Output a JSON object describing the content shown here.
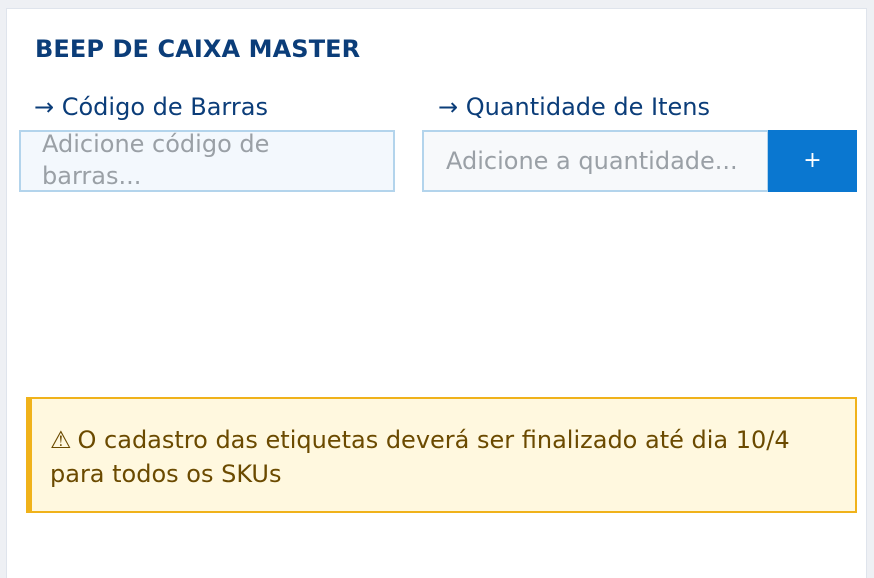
{
  "header": {
    "title": "BEEP DE CAIXA MASTER"
  },
  "barcode": {
    "label": "→ Código de Barras",
    "placeholder": "Adicione código de barras..."
  },
  "quantity": {
    "label": "→ Quantidade de Itens",
    "placeholder": "Adicione a quantidade..."
  },
  "add_button": {
    "label": "+"
  },
  "alert": {
    "icon": "⚠",
    "icon_name": "warning-icon",
    "message": "O cadastro das etiquetas deverá ser finalizado até dia 10/4 para todos os SKUs"
  },
  "colors": {
    "title": "#0b3d79",
    "button": "#0a77d0",
    "alert_bg": "#fff8df",
    "alert_border": "#f0b21a",
    "alert_text": "#6b4a00"
  }
}
